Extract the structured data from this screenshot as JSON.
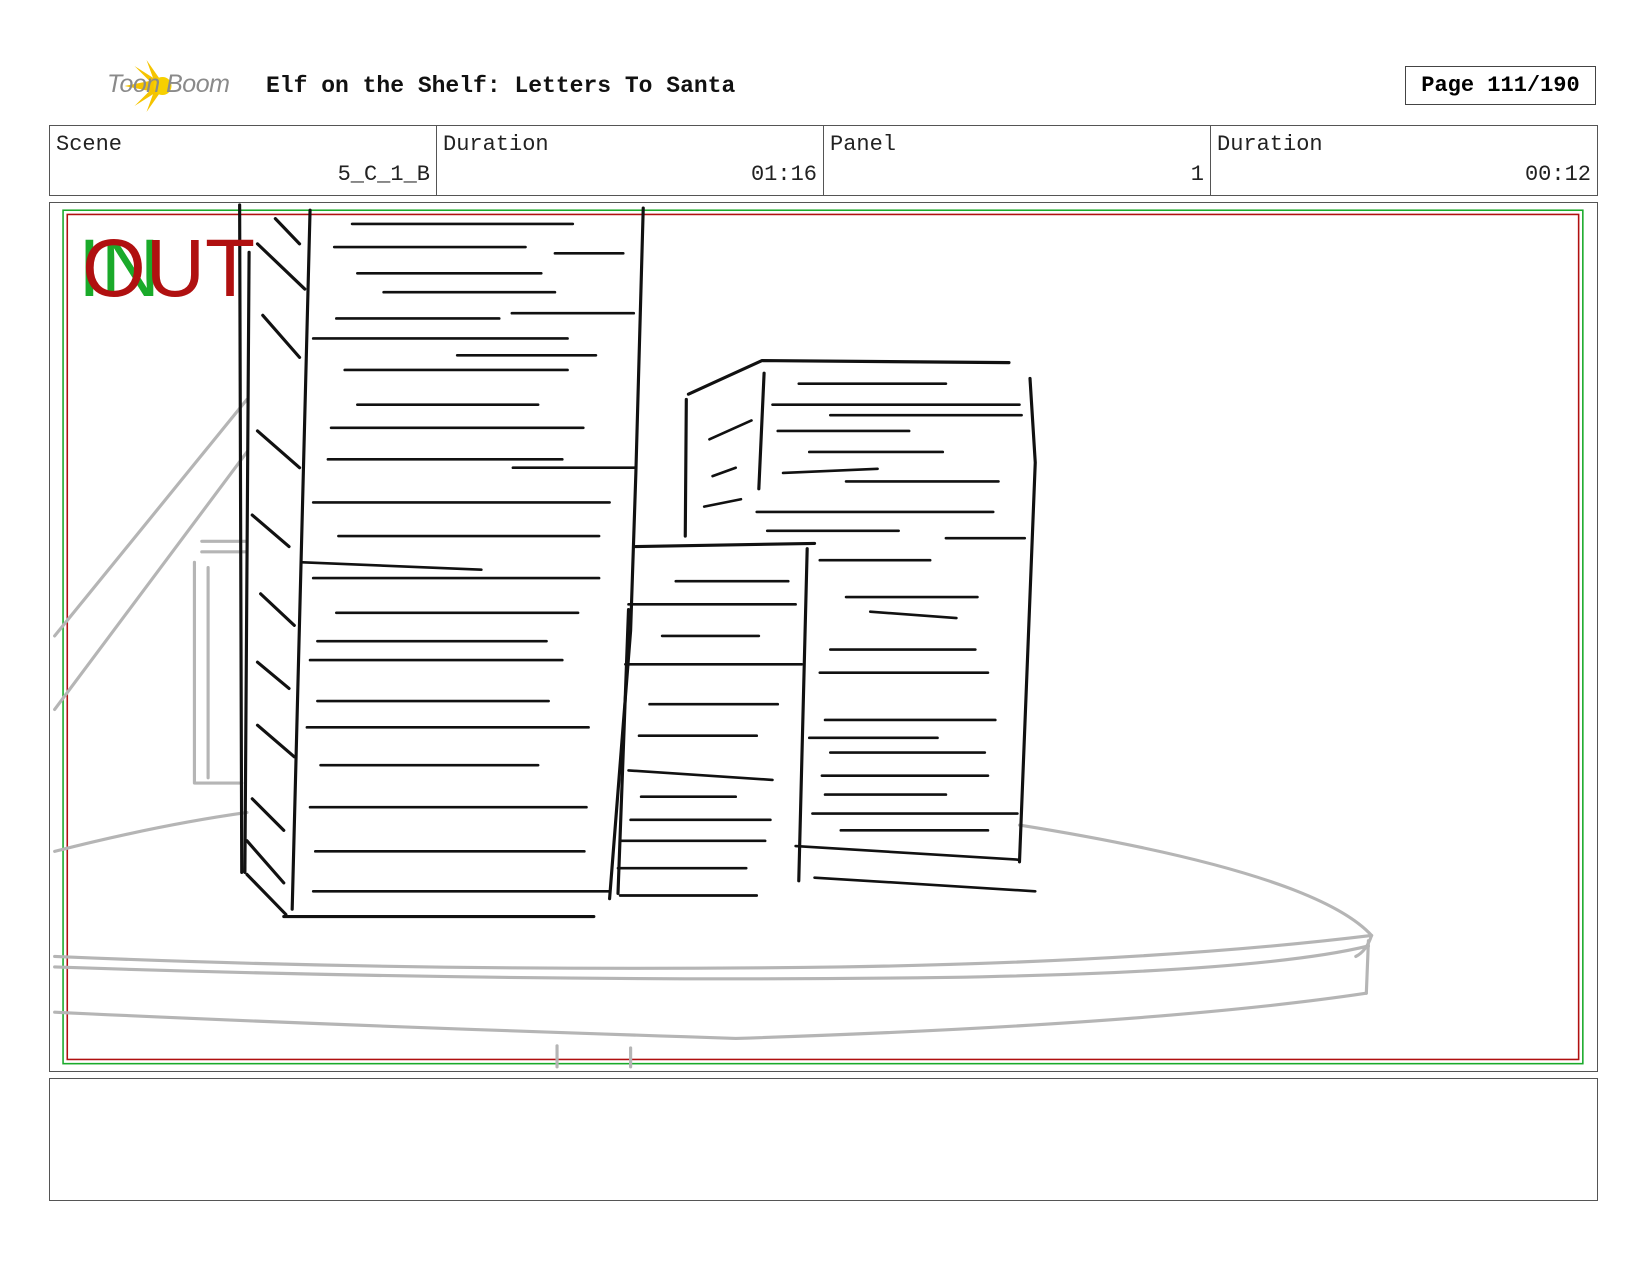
{
  "header": {
    "logo_text": "Toon Boom",
    "title": "Elf on the Shelf: Letters To Santa",
    "page": "Page 111/190"
  },
  "info": {
    "scene_label": "Scene",
    "scene_value": "5_C_1_B",
    "scene_duration_label": "Duration",
    "scene_duration_value": "01:16",
    "panel_label": "Panel",
    "panel_value": "1",
    "panel_duration_label": "Duration",
    "panel_duration_value": "00:12"
  },
  "panel": {
    "in_marker": "IN",
    "out_marker": "OUT",
    "safe_frame_colors": {
      "inner": "#b01010",
      "outer": "#1aaa2a"
    }
  },
  "notes": {}
}
